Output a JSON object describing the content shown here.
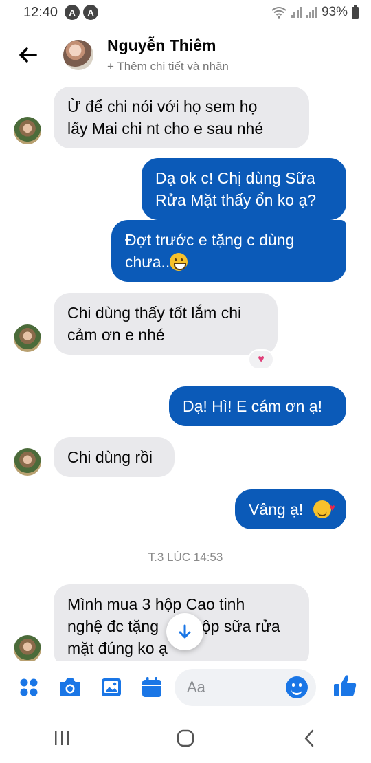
{
  "status_bar": {
    "time": "12:40",
    "app_icon": "A",
    "battery": "93%"
  },
  "header": {
    "name": "Nguyễn Thiêm",
    "subtitle": "+ Thêm chi tiết và nhãn"
  },
  "messages": [
    {
      "dir": "in",
      "lines": [
        "Ừ để chi nói với họ sem họ",
        "lấy Mai chi nt cho e sau nhé"
      ]
    },
    {
      "dir": "out",
      "lines": [
        "Dạ ok c! Chị dùng Sữa",
        "Rửa Mặt thấy ổn ko ạ?"
      ]
    },
    {
      "dir": "out",
      "lines": [
        "Đợt trước e tặng c dùng",
        "chưa.."
      ],
      "emoji": "grinning-face"
    },
    {
      "dir": "in",
      "lines": [
        "Chi dùng thấy tốt lắm chi",
        "cảm ơn e nhé"
      ],
      "reaction": "heart"
    },
    {
      "dir": "out",
      "lines": [
        "Dạ! Hì! E cám ơn ạ!"
      ]
    },
    {
      "dir": "in",
      "lines": [
        "Chi dùng rồi"
      ]
    },
    {
      "dir": "out",
      "lines": [
        "Vâng ạ!"
      ],
      "emoji": "smiling-face-with-hearts"
    },
    {
      "dir": "in",
      "lines": [
        "Mình mua 3 hộp Cao tinh",
        "nghệ đc tặng",
        "hộp sữa rửa",
        "mặt đúng ko ạ"
      ]
    }
  ],
  "timestamp": "T.3 LÚC 14:53",
  "composer": {
    "placeholder": "Aa"
  },
  "icons": {
    "back": "arrow-left-icon",
    "apps": "apps-grid-icon",
    "camera": "camera-icon",
    "gallery": "image-icon",
    "calendar": "calendar-icon",
    "emoji": "emoji-icon",
    "like": "thumbs-up-icon",
    "scroll": "arrow-down-icon"
  },
  "colors": {
    "accent": "#1a76e6",
    "outgoing_bubble": "#0b5ab8",
    "incoming_bubble": "#e9e9ec"
  }
}
